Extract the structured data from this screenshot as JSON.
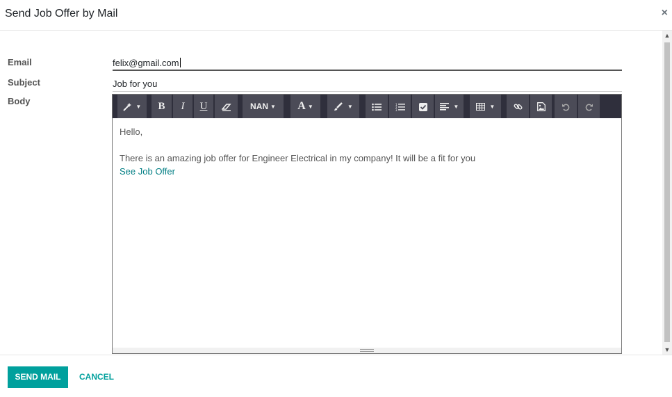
{
  "dialog": {
    "title": "Send Job Offer by Mail",
    "close_glyph": "×"
  },
  "form": {
    "email_label": "Email",
    "email_value": "felix@gmail.com",
    "subject_label": "Subject",
    "subject_value": "Job for you",
    "body_label": "Body"
  },
  "toolbar": {
    "font_size_label": "NAN",
    "icons": [
      "magic-wand-icon",
      "bold-icon",
      "italic-icon",
      "underline-icon",
      "eraser-icon",
      "font-size-dropdown",
      "font-color-icon",
      "paint-brush-icon",
      "unordered-list-icon",
      "ordered-list-icon",
      "checklist-icon",
      "align-icon",
      "table-icon",
      "link-icon",
      "image-icon",
      "undo-icon",
      "redo-icon"
    ]
  },
  "body": {
    "greeting": "Hello,",
    "message": "There is an amazing job offer for Engineer Electrical in my company! It will be a fit for you",
    "link_text": "See Job Offer"
  },
  "footer": {
    "send_label": "SEND MAIL",
    "cancel_label": "CANCEL"
  },
  "colors": {
    "primary": "#00a09d",
    "link": "#017e84",
    "toolbar_bg": "#2f2f3c",
    "toolbar_button": "#4b4b57"
  }
}
